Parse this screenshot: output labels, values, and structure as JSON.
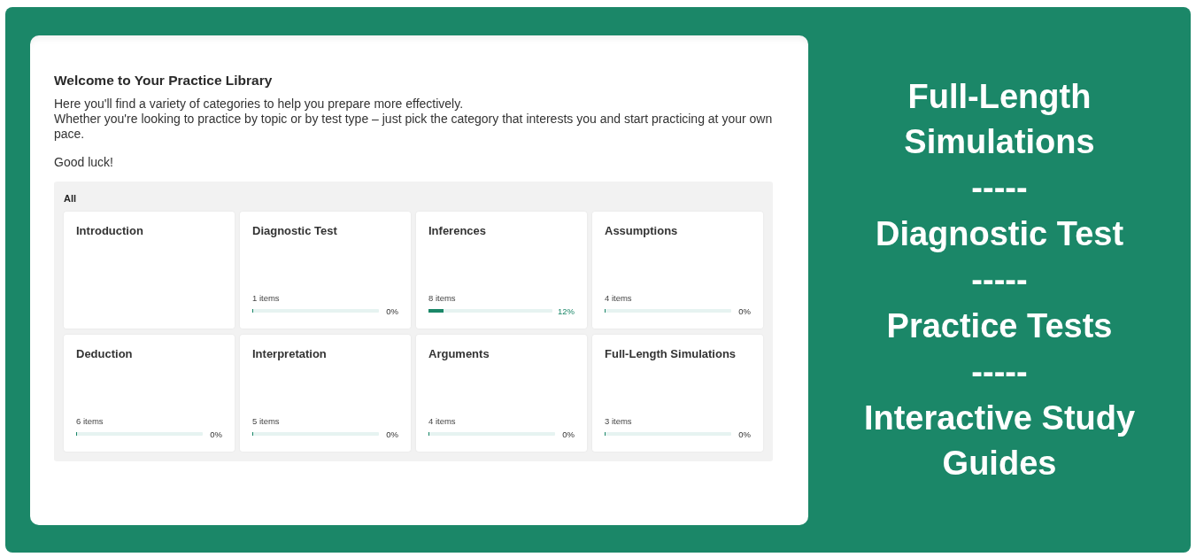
{
  "library": {
    "title": "Welcome to Your Practice Library",
    "intro_lines": [
      "Here you'll find a variety of categories to help you prepare more effectively.",
      "Whether you're looking to practice by topic or by test type – just pick the category that interests you and start practicing at your own pace."
    ],
    "closing": "Good luck!",
    "filter_label": "All",
    "categories": [
      {
        "title": "Introduction"
      },
      {
        "title": "Diagnostic Test",
        "count": "1 items",
        "level": 0,
        "percent": "0%"
      },
      {
        "title": "Inferences",
        "count": "8 items",
        "level": 0.12,
        "percent": "12%"
      },
      {
        "title": "Assumptions",
        "count": "4 items",
        "level": 0,
        "percent": "0%"
      },
      {
        "title": "Deduction",
        "count": "6 items",
        "level": 0,
        "percent": "0%"
      },
      {
        "title": "Interpretation",
        "count": "5 items",
        "level": 0,
        "percent": "0%"
      },
      {
        "title": "Arguments",
        "count": "4 items",
        "level": 0,
        "percent": "0%"
      },
      {
        "title": "Full-Length Simulations",
        "count": "3 items",
        "level": 0,
        "percent": "0%"
      }
    ]
  },
  "promo": {
    "lines": [
      {
        "kind": "heading",
        "text": "Full-Length Simulations"
      },
      {
        "kind": "separator",
        "text": "-----"
      },
      {
        "kind": "heading",
        "text": "Diagnostic Test"
      },
      {
        "kind": "separator",
        "text": "-----"
      },
      {
        "kind": "heading",
        "text": "Practice Tests"
      },
      {
        "kind": "separator",
        "text": "-----"
      },
      {
        "kind": "heading",
        "text": "Interactive Study Guides"
      }
    ]
  }
}
